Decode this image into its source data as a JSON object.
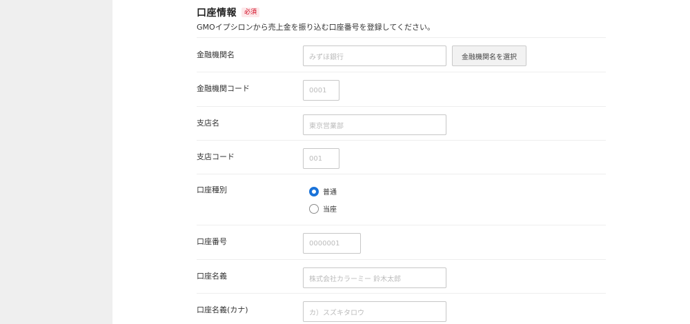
{
  "section": {
    "title": "口座情報",
    "required_badge": "必須",
    "description": "GMOイプシロンから売上金を振り込む口座番号を登録してください。"
  },
  "fields": {
    "bank_name": {
      "label": "金融機関名",
      "placeholder": "みずほ銀行",
      "select_button": "金融機関名を選択"
    },
    "bank_code": {
      "label": "金融機関コード",
      "placeholder": "0001"
    },
    "branch_name": {
      "label": "支店名",
      "placeholder": "東京営業部"
    },
    "branch_code": {
      "label": "支店コード",
      "placeholder": "001"
    },
    "account_type": {
      "label": "口座種別",
      "options": [
        {
          "label": "普通",
          "checked": true
        },
        {
          "label": "当座",
          "checked": false
        }
      ]
    },
    "account_number": {
      "label": "口座番号",
      "placeholder": "0000001"
    },
    "account_holder": {
      "label": "口座名義",
      "placeholder": "株式会社カラーミー 鈴木太郎"
    },
    "account_holder_kana": {
      "label": "口座名義(カナ)",
      "placeholder": "カ）スズキタロウ"
    }
  },
  "colors": {
    "accent": "#1a73d9",
    "required": "#d0021b",
    "sidebar": "#efefef"
  }
}
